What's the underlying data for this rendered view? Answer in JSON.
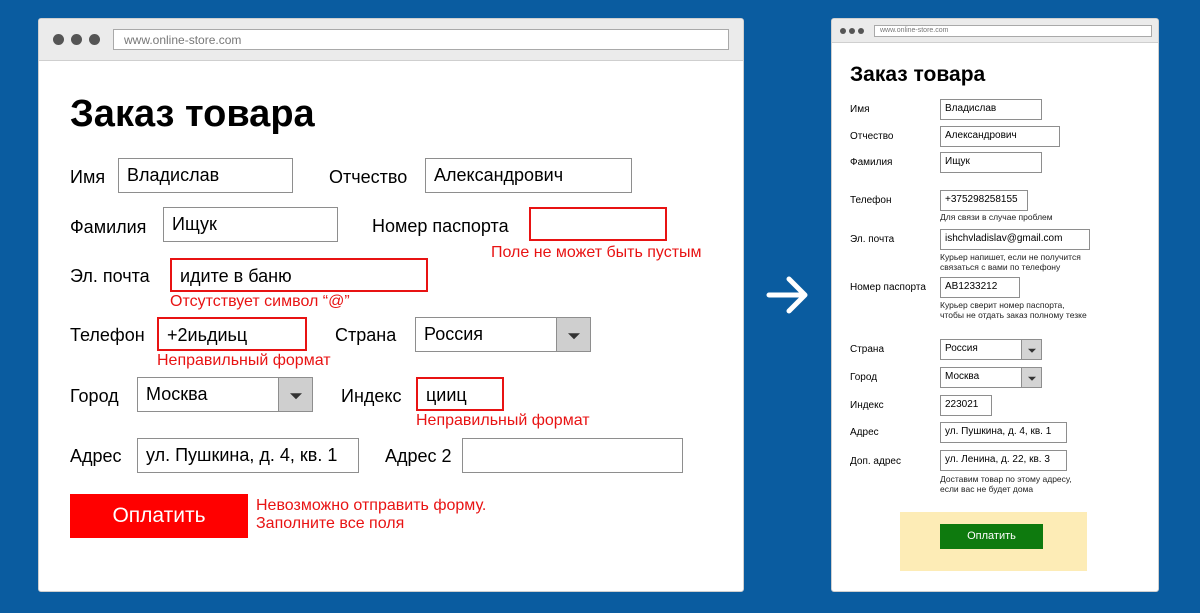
{
  "left": {
    "url": "www.online-store.com",
    "title": "Заказ товара",
    "labels": {
      "name": "Имя",
      "patronymic": "Отчество",
      "surname": "Фамилия",
      "passport": "Номер паспорта",
      "email": "Эл. почта",
      "phone": "Телефон",
      "country": "Страна",
      "city": "Город",
      "index": "Индекс",
      "address": "Адрес",
      "address2": "Адрес 2"
    },
    "values": {
      "name": "Владислав",
      "patronymic": "Александрович",
      "surname": "Ищук",
      "passport": "",
      "email": "идите в баню",
      "phone": "+2иьдиьц",
      "country": "Россия",
      "city": "Москва",
      "index": "цииц",
      "address": "ул. Пушкина, д. 4, кв. 1",
      "address2": ""
    },
    "errors": {
      "passport": "Поле не может быть пустым",
      "email": "Отсутствует символ “@”",
      "phone": "Неправильный формат",
      "index": "Неправильный формат",
      "submit_line1": "Невозможно отправить форму.",
      "submit_line2": "Заполните все поля"
    },
    "submit_label": "Оплатить",
    "colors": {
      "error": "#e81313",
      "button": "#ff0000"
    }
  },
  "right": {
    "url": "www.online-store.com",
    "title": "Заказ товара",
    "labels": {
      "name": "Имя",
      "patronymic": "Отчество",
      "surname": "Фамилия",
      "phone": "Телефон",
      "email": "Эл. почта",
      "passport": "Номер паспорта",
      "country": "Страна",
      "city": "Город",
      "index": "Индекс",
      "address": "Адрес",
      "address2": "Доп. адрес"
    },
    "values": {
      "name": "Владислав",
      "patronymic": "Александрович",
      "surname": "Ищук",
      "phone": "+375298258155",
      "email": "ishchvladislav@gmail.com",
      "passport": "AB1233212",
      "country": "Россия",
      "city": "Москва",
      "index": "223021",
      "address": "ул. Пушкина, д. 4, кв. 1",
      "address2": "ул. Ленина, д. 22, кв. 3"
    },
    "hints": {
      "phone": "Для связи в случае проблем",
      "email_line1": "Курьер напишет, если не получится",
      "email_line2": "связаться с вами по телефону",
      "passport_line1": "Курьер сверит номер паспорта,",
      "passport_line2": "чтобы не отдать заказ полному тезке",
      "address2_line1": "Доставим товар по этому адресу,",
      "address2_line2": "если вас не будет дома"
    },
    "submit_label": "Оплатить",
    "colors": {
      "button": "#0e7a0e",
      "panel": "#fdecb6"
    }
  },
  "icons": {
    "transition": "arrow-right-icon"
  },
  "background_color": "#0a5ca0"
}
